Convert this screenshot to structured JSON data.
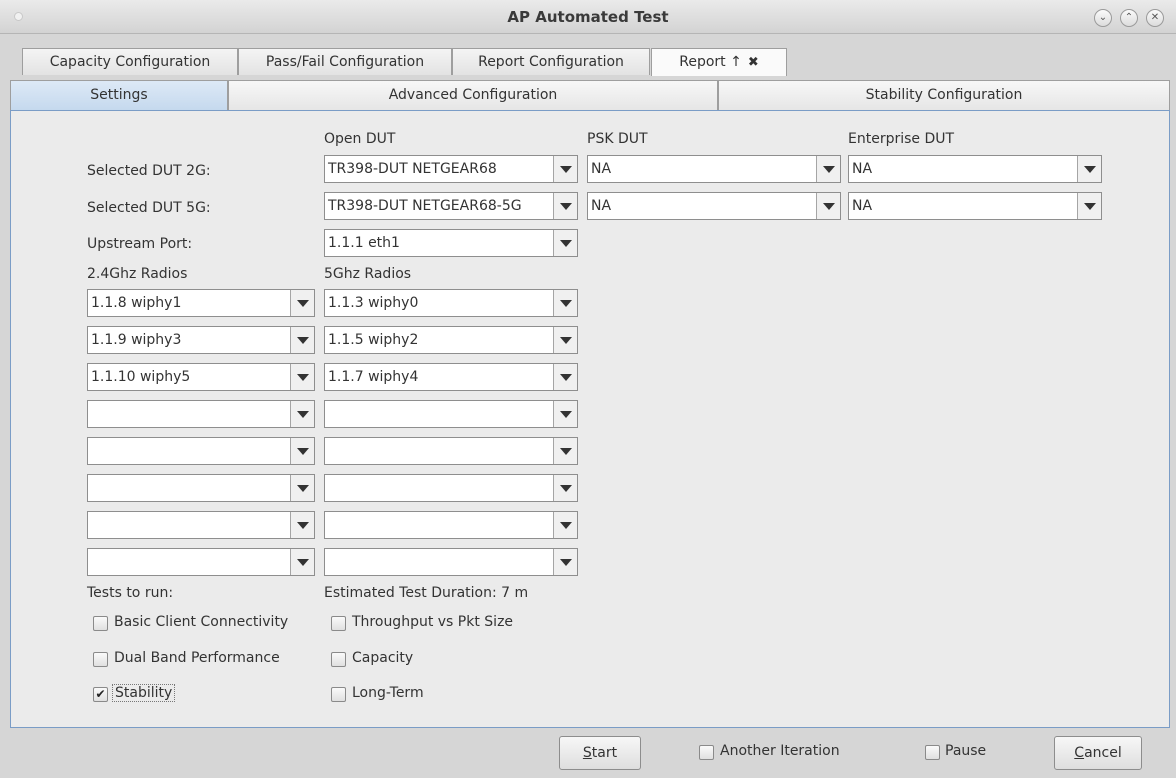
{
  "window": {
    "title": "AP Automated Test"
  },
  "tabs": [
    {
      "label": "Capacity Configuration"
    },
    {
      "label": "Pass/Fail Configuration"
    },
    {
      "label": "Report Configuration"
    },
    {
      "label": "Report ↑",
      "close": "✖"
    }
  ],
  "subtabs": [
    {
      "label": "Settings"
    },
    {
      "label": "Advanced Configuration"
    },
    {
      "label": "Stability Configuration"
    }
  ],
  "settings": {
    "col_open": "Open DUT",
    "col_psk": "PSK DUT",
    "col_enterprise": "Enterprise DUT",
    "dut2g_label": "Selected DUT 2G:",
    "dut5g_label": "Selected DUT 5G:",
    "upstream_label": "Upstream Port:",
    "dut2g": {
      "open": "TR398-DUT NETGEAR68",
      "psk": "NA",
      "enterprise": "NA"
    },
    "dut5g": {
      "open": "TR398-DUT NETGEAR68-5G",
      "psk": "NA",
      "enterprise": "NA"
    },
    "upstream": "1.1.1 eth1",
    "radios24_label": "2.4Ghz Radios",
    "radios5_label": "5Ghz Radios",
    "radios24": [
      "1.1.8 wiphy1",
      "1.1.9 wiphy3",
      "1.1.10 wiphy5",
      "",
      "",
      "",
      "",
      ""
    ],
    "radios5": [
      "1.1.3 wiphy0",
      "1.1.5 wiphy2",
      "1.1.7 wiphy4",
      "",
      "",
      "",
      "",
      ""
    ],
    "tests_label": "Tests to run:",
    "duration_label": "Estimated Test Duration: 7 m",
    "tests": [
      {
        "label": "Basic Client Connectivity",
        "checked": false
      },
      {
        "label": "Throughput vs Pkt Size",
        "checked": false
      },
      {
        "label": "Dual Band Performance",
        "checked": false
      },
      {
        "label": "Capacity",
        "checked": false
      },
      {
        "label": "Stability",
        "checked": true
      },
      {
        "label": "Long-Term",
        "checked": false
      }
    ]
  },
  "footer": {
    "start_first": "S",
    "start_rest": "tart",
    "another_iteration": "Another Iteration",
    "pause": "Pause",
    "cancel_first": "C",
    "cancel_rest": "ancel"
  }
}
